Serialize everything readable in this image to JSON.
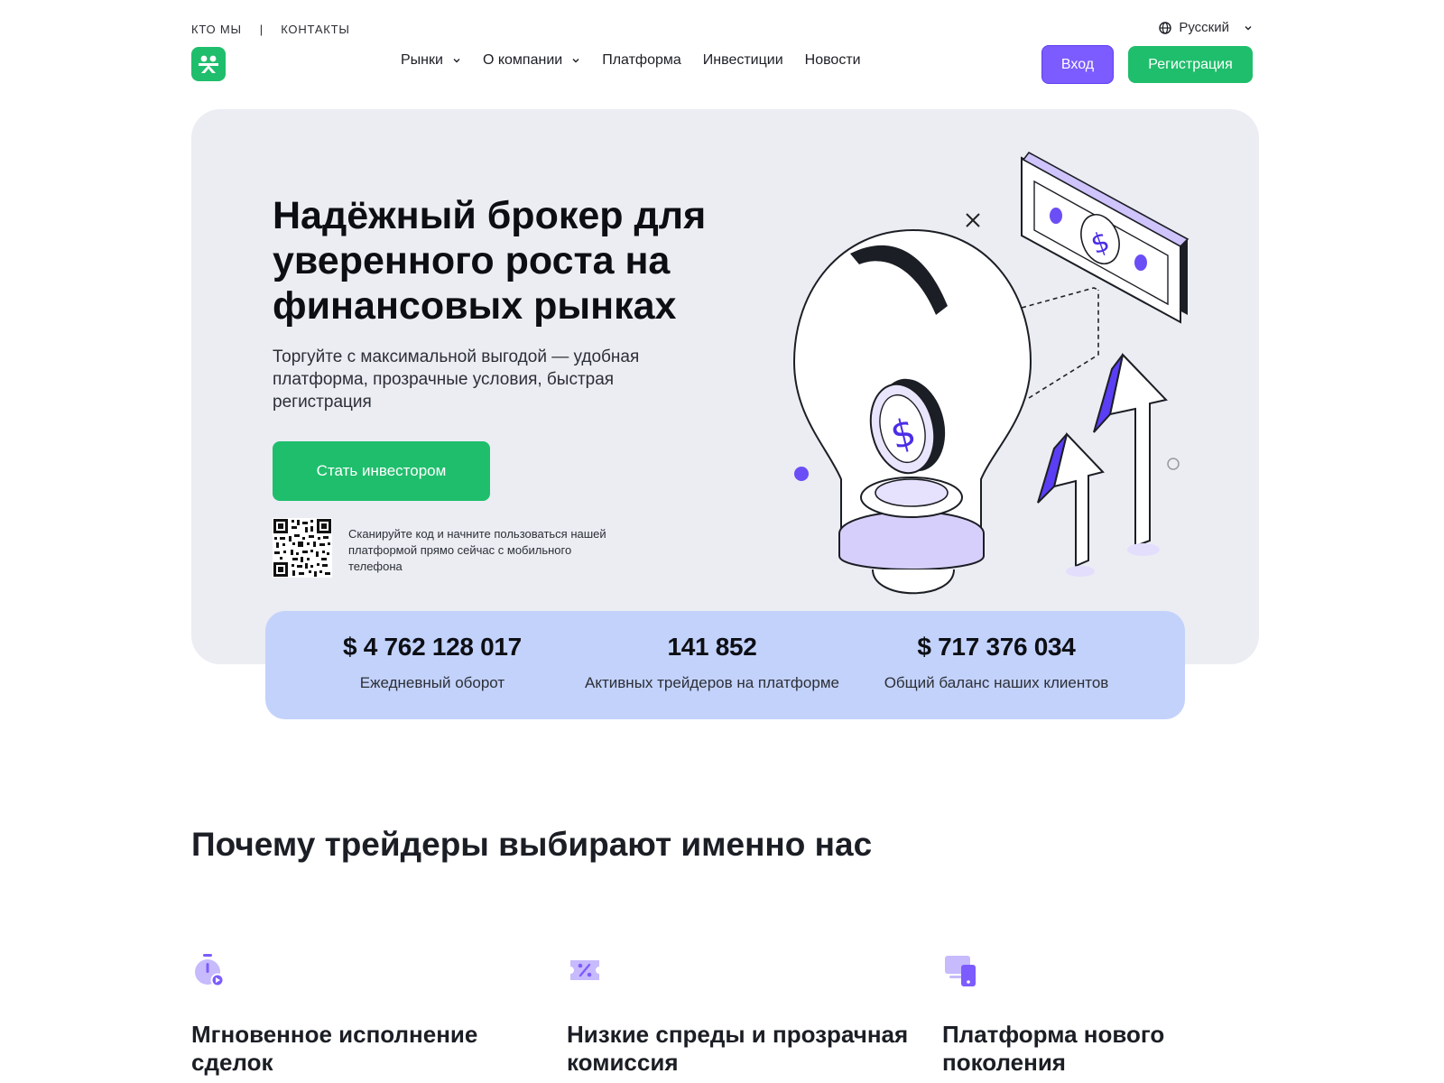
{
  "topbar": {
    "links": [
      "КТО МЫ",
      "КОНТАКТЫ"
    ],
    "separator": "|",
    "language": "Русский"
  },
  "nav": {
    "items": [
      {
        "label": "Рынки",
        "has_dropdown": true
      },
      {
        "label": "О компании",
        "has_dropdown": true
      },
      {
        "label": "Платформа",
        "has_dropdown": false
      },
      {
        "label": "Инвестиции",
        "has_dropdown": false
      },
      {
        "label": "Новости",
        "has_dropdown": false
      }
    ],
    "login_label": "Вход",
    "register_label": "Регистрация"
  },
  "hero": {
    "title": "Надёжный брокер для уверенного роста на финансовых рынках",
    "subtitle": "Торгуйте с максимальной выгодой — удобная платформа, прозрачные условия, быстрая регистрация",
    "cta_label": "Стать инвестором",
    "qr_text": "Сканируйте код и начните пользоваться нашей платформой прямо сейчас с мобильного телефона"
  },
  "stats": [
    {
      "value": "$ 4 762 128 017",
      "label": "Ежедневный оборот"
    },
    {
      "value": "141 852",
      "label": "Активных трейдеров на платформе"
    },
    {
      "value": "$ 717 376 034",
      "label": "Общий баланс наших клиентов"
    }
  ],
  "why": {
    "title": "Почему трейдеры выбирают именно нас",
    "features": [
      {
        "icon": "stopwatch-icon",
        "title": "Мгновенное исполнение сделок"
      },
      {
        "icon": "percent-ticket-icon",
        "title": "Низкие спреды и прозрачная комиссия"
      },
      {
        "icon": "devices-icon",
        "title": "Платформа нового поколения"
      }
    ]
  },
  "colors": {
    "brand_green": "#1fbe6c",
    "login_purple": "#7c5cff",
    "hero_bg": "#ebedf3",
    "stats_bg": "#c3d2fb",
    "icon_purple": "#7c5cff"
  }
}
